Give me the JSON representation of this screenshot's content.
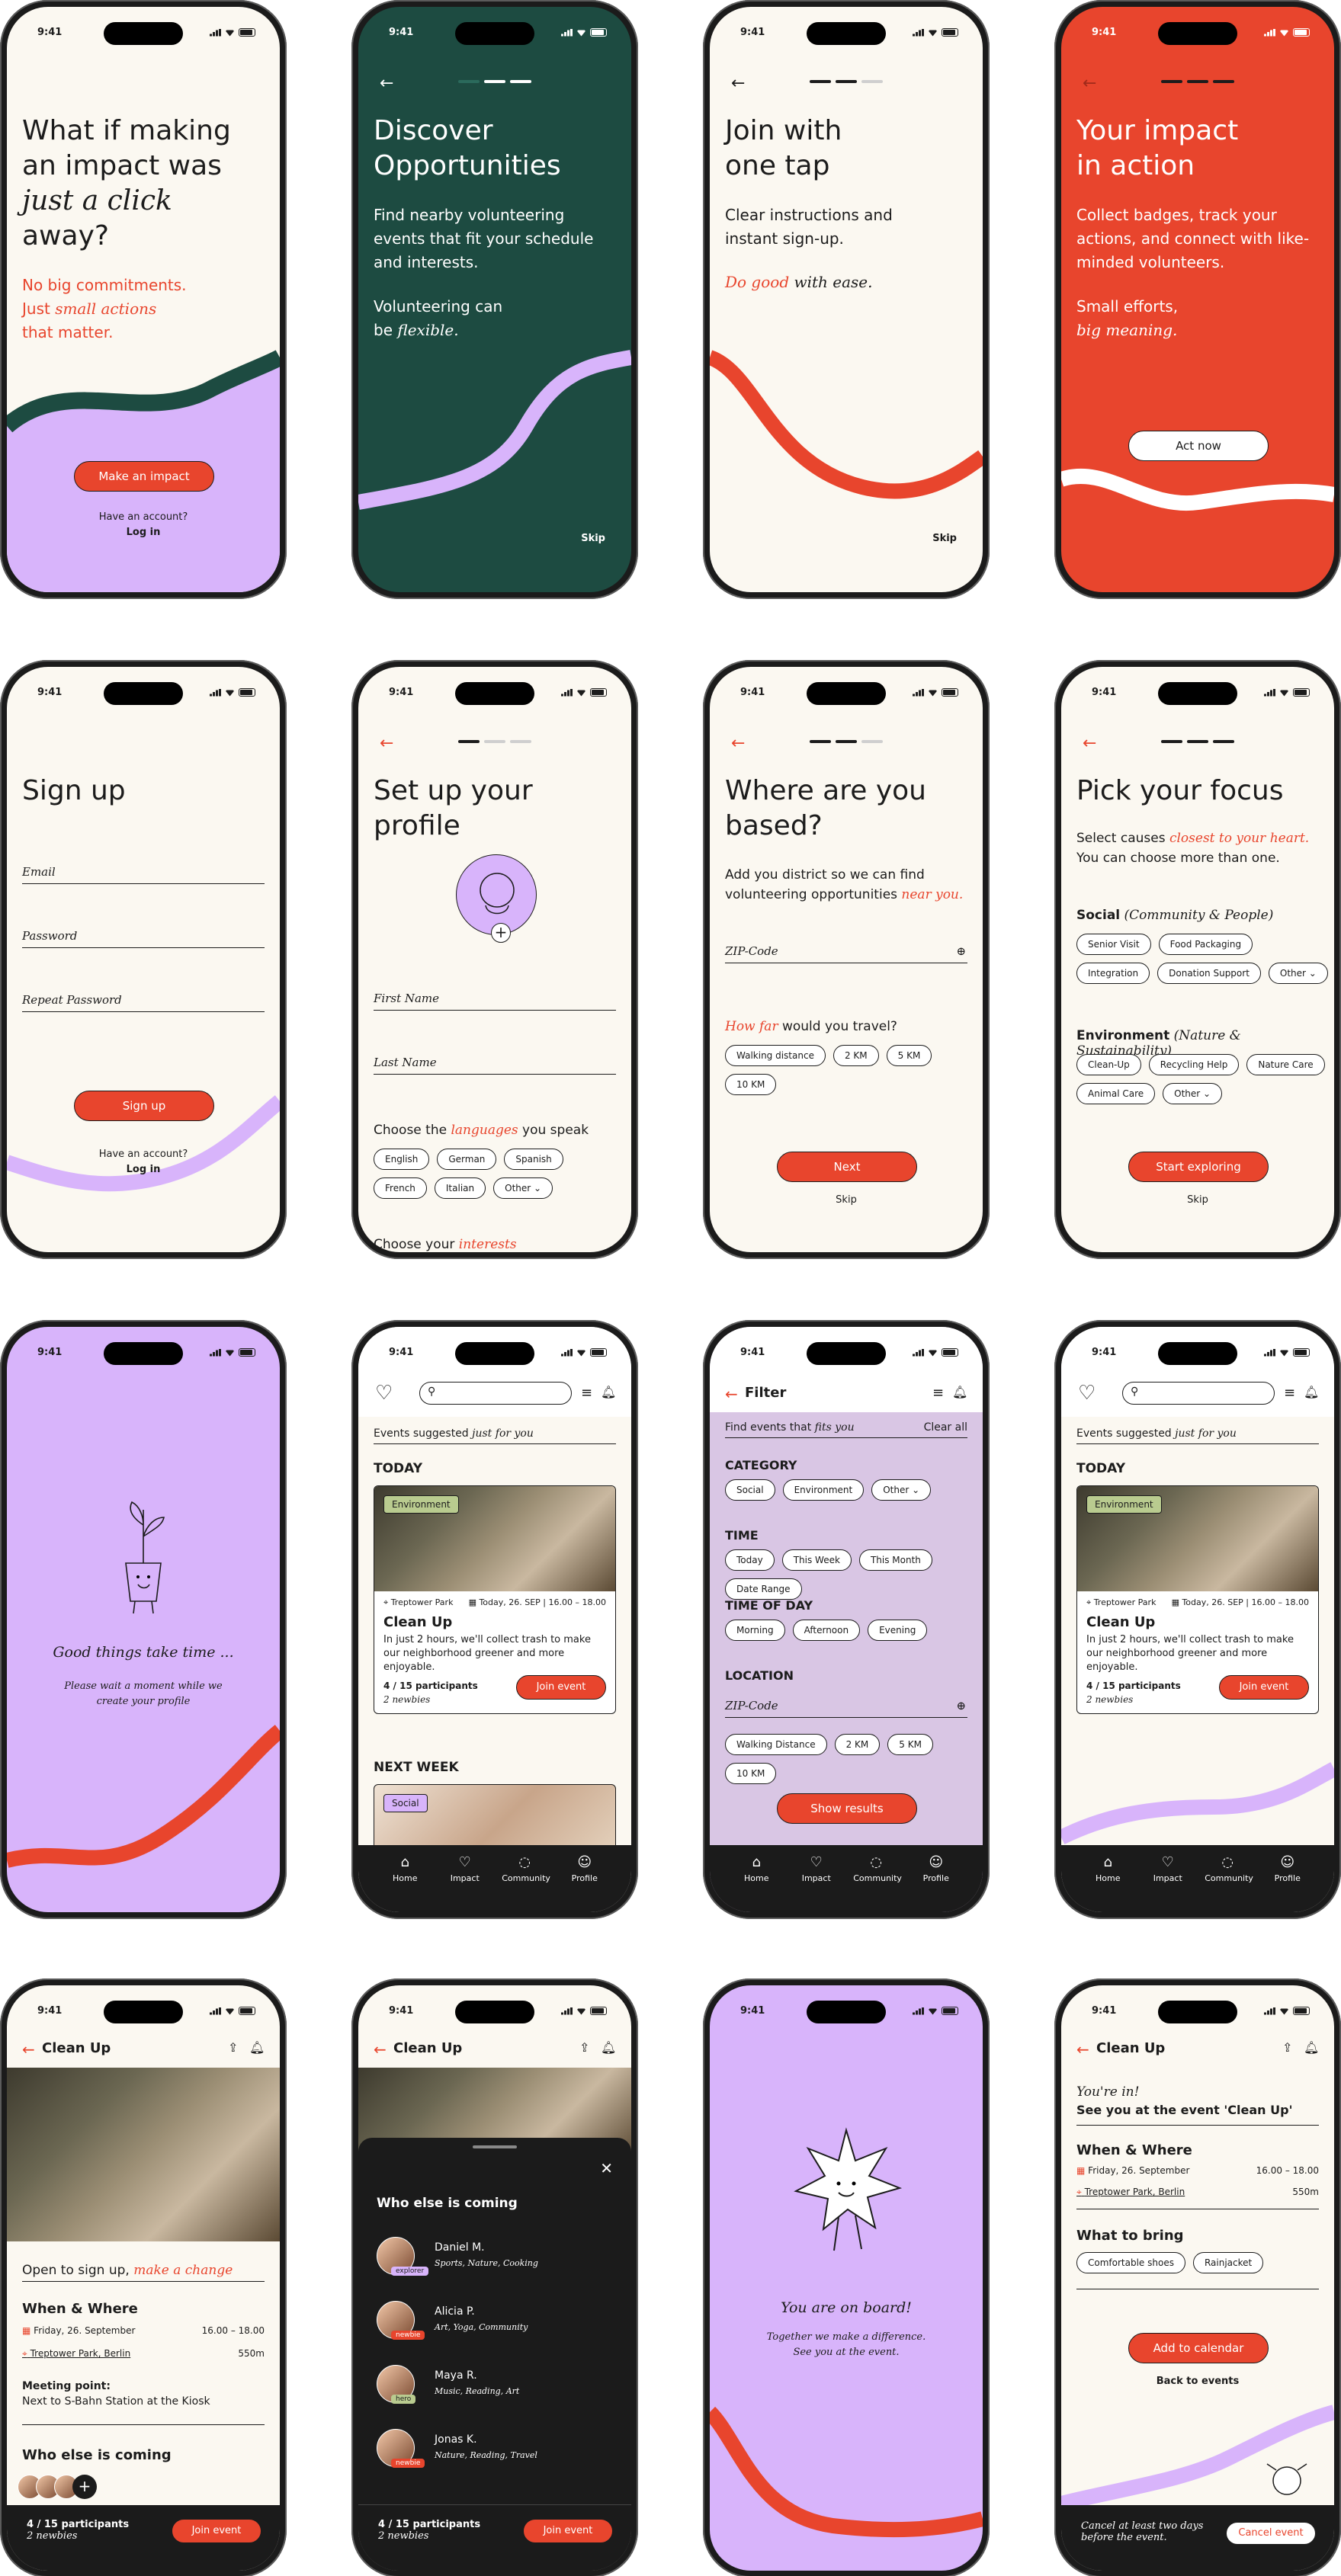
{
  "status_time": "9:41",
  "onb1": {
    "title1": "What if making",
    "title2": "an impact was",
    "title3": "just a click",
    "title4": "away?",
    "sub1": "No big commitments.",
    "sub2a": "Just ",
    "sub2b": "small actions",
    "sub3": "that matter.",
    "cta": "Make an impact",
    "account": "Have an account?",
    "login": "Log in"
  },
  "onb2": {
    "title1": "Discover",
    "title2": "Opportunities",
    "body": "Find nearby volunteering events that fit your schedule and interests.",
    "body2a": "Volunteering can",
    "body2b": "be ",
    "body2c": "flexible.",
    "skip": "Skip"
  },
  "onb3": {
    "title1": "Join with",
    "title2": "one tap",
    "body": "Clear instructions and instant sign-up.",
    "italic1": "Do good",
    "italic2": " with ease.",
    "skip": "Skip"
  },
  "onb4": {
    "title1": "Your impact",
    "title2": "in action",
    "body": "Collect badges, track your actions, and connect with like-minded volunteers.",
    "small1": "Small efforts,",
    "small2": "big meaning.",
    "cta": "Act now"
  },
  "signup": {
    "title": "Sign up",
    "email": "Email",
    "password": "Password",
    "repeat": "Repeat Password",
    "cta": "Sign up",
    "account": "Have an account?",
    "login": "Log in"
  },
  "profile": {
    "title1": "Set up your",
    "title2": "profile",
    "first": "First Name",
    "last": "Last Name",
    "lang_a": "Choose the ",
    "lang_b": "languages",
    "lang_c": " you speak",
    "langs": [
      "English",
      "German",
      "Spanish",
      "French",
      "Italian",
      "Other"
    ],
    "interests_a": "Choose your ",
    "interests_b": "interests"
  },
  "based": {
    "title1": "Where are you",
    "title2": "based?",
    "body": "Add you district so we can find volunteering opportunities ",
    "body_red": "near you.",
    "zip": "ZIP-Code",
    "travel_a": "How far",
    "travel_b": " would you travel?",
    "dists": [
      "Walking distance",
      "2 KM",
      "5 KM",
      "10 KM"
    ],
    "next": "Next",
    "skip": "Skip"
  },
  "focus": {
    "title": "Pick your focus",
    "body_a": "Select causes ",
    "body_b": "closest to your heart.",
    "body2": "You can choose more than one.",
    "social": "Social",
    "social_sub": "(Community & People)",
    "social_chips": [
      "Senior Visit",
      "Food Packaging",
      "Integration",
      "Donation Support",
      "Other"
    ],
    "env": "Environment",
    "env_sub": "(Nature & Sustainability)",
    "env_chips": [
      "Clean-Up",
      "Recycling Help",
      "Nature Care",
      "Animal Care",
      "Other"
    ],
    "cta": "Start exploring",
    "skip": "Skip"
  },
  "loading": {
    "title": "Good things take time ...",
    "sub1": "Please wait a moment while we",
    "sub2": "create your profile"
  },
  "feed": {
    "suggest_a": "Events suggested ",
    "suggest_b": "just for you",
    "today": "TODAY",
    "tag": "Environment",
    "place": "Treptower Park",
    "date": "Today, 26. SEP | 16.00 – 18.00",
    "event": "Clean Up",
    "desc": "In just 2 hours, we'll collect trash to make our neighborhood greener and more enjoyable.",
    "participants": "4 / 15 participants",
    "newbies": "2 newbies",
    "join": "Join event",
    "next_week": "NEXT WEEK",
    "tag2": "Social"
  },
  "tabs": [
    "Home",
    "Impact",
    "Community",
    "Profile"
  ],
  "filter": {
    "title": "Filter",
    "find_a": "Find events that ",
    "find_b": "fits you",
    "clear": "Clear all",
    "category": "CATEGORY",
    "cats": [
      "Social",
      "Environment",
      "Other"
    ],
    "time": "TIME",
    "times": [
      "Today",
      "This Week",
      "This Month",
      "Date Range"
    ],
    "tod": "TIME OF DAY",
    "tods": [
      "Morning",
      "Afternoon",
      "Evening"
    ],
    "location": "LOCATION",
    "zip": "ZIP-Code",
    "dists": [
      "Walking Distance",
      "2 KM",
      "5 KM",
      "10 KM"
    ],
    "show": "Show results"
  },
  "detail": {
    "title": "Clean Up",
    "open_a": "Open to sign up, ",
    "open_b": "make a change",
    "when": "When & Where",
    "date": "Friday, 26. September",
    "time": "16.00 – 18.00",
    "place": "Treptower Park, Berlin",
    "dist": "550m",
    "meet_label": "Meeting point:",
    "meet": "Next to S-Bahn Station at the Kiosk",
    "who": "Who else is coming",
    "participants": "4 / 15 participants",
    "newbies": "2 newbies",
    "join": "Join event"
  },
  "sheet": {
    "title": "Who else is coming",
    "people": [
      {
        "name": "Daniel M.",
        "tags": "Sports, Nature, Cooking",
        "badge": "explorer"
      },
      {
        "name": "Alicia P.",
        "tags": "Art, Yoga, Community",
        "badge": "newbie"
      },
      {
        "name": "Maya R.",
        "tags": "Music, Reading, Art",
        "badge": "hero"
      },
      {
        "name": "Jonas K.",
        "tags": "Nature, Reading, Travel",
        "badge": "newbie"
      }
    ]
  },
  "onboard": {
    "title": "You are on board!",
    "sub1": "Together we make a difference.",
    "sub2": "See you at the event."
  },
  "confirm": {
    "title": "Clean Up",
    "in": "You're in!",
    "see": "See you at the event 'Clean Up'",
    "when": "When & Where",
    "date": "Friday, 26. September",
    "time": "16.00 – 18.00",
    "place": "Treptower Park, Berlin",
    "dist": "550m",
    "bring": "What to bring",
    "items": [
      "Comfortable shoes",
      "Rainjacket"
    ],
    "cal": "Add to calendar",
    "back": "Back to events",
    "cancel_note1": "Cancel at least two days",
    "cancel_note2": "before the event.",
    "cancel": "Cancel event"
  },
  "colors": {
    "cream": "#fbf8f1",
    "green": "#1d4b41",
    "orange": "#e8452d",
    "lilac": "#d8b4fb",
    "dark": "#1b1b1b"
  }
}
